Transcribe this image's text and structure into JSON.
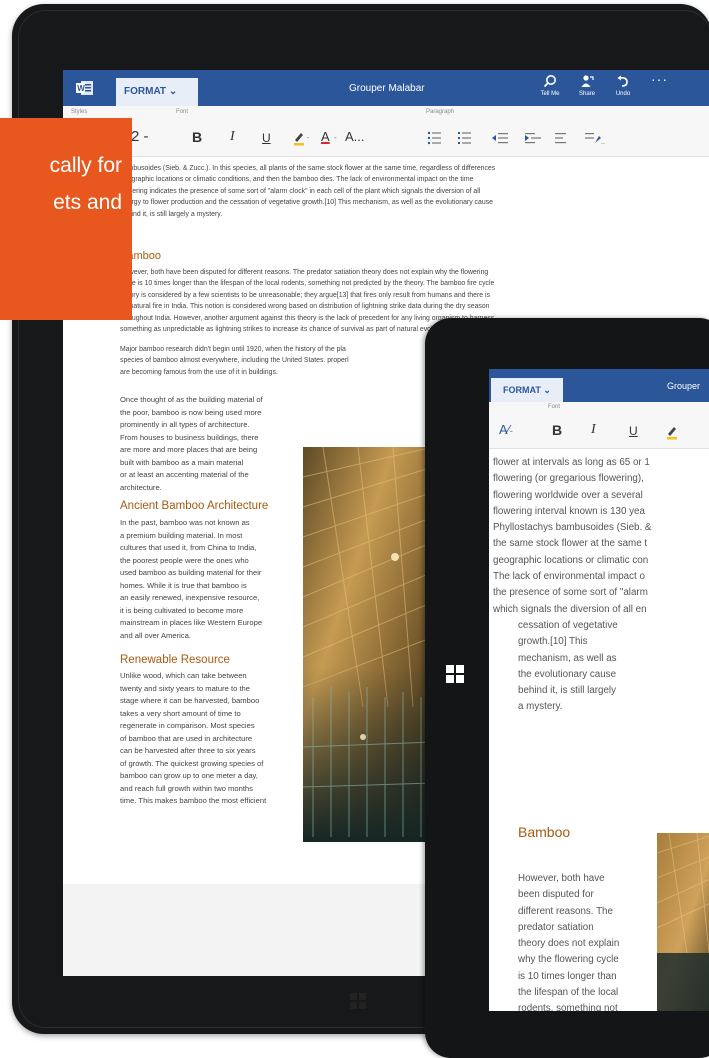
{
  "big_tablet": {
    "app": {
      "format_tab": "FORMAT",
      "doc_title": "Grouper Malabar",
      "commands": {
        "tell_me": "Tell Me",
        "share": "Share",
        "undo": "Undo"
      },
      "more": "···"
    },
    "toolbar": {
      "groups": {
        "styles": "Styles",
        "font": "Font",
        "paragraph": "Paragraph"
      },
      "style_value": "Heading 2 -",
      "bold": "B",
      "italic": "I",
      "underline": "U",
      "font_color": "A",
      "font_more": "A...",
      "highlight_color": "#f4c21a",
      "font_color_bar": "#d9262b"
    },
    "doc": {
      "intro_lines": [
        "bambusoides (Sieb. & Zucc.). In this species, all plants of the same stock flower at the same time, regardless of differences",
        "geographic locations or climatic conditions, and then the bamboo dies. The lack of environmental impact on the time",
        "flowering indicates the presence of some sort of \"alarm clock\" in each cell of the plant which signals the diversion of all",
        "energy to flower production and the cessation of vegetative growth.[10] This mechanism, as well as the evolutionary cause",
        "behind it, is still largely a mystery."
      ],
      "heading1": "Bamboo",
      "para1_lines": [
        "However, both have been disputed for different reasons. The predator satiation theory does not explain why the flowering",
        "cycle is 10 times longer than the lifespan of the local rodents, something not predicted by the theory. The bamboo fire cycle",
        "theory is considered by a few scientists to be unreasonable; they argue[13] that fires only result from humans and there is",
        "no natural fire in India. This notion is considered wrong based on distribution of lightning strike data during the dry season",
        "throughout India. However, another argument against this theory is the lack of precedent for any living organism to harness",
        "something as unpredictable as lightning strikes to increase its chance of survival as part of natural evolutionary progress.[14]"
      ],
      "para2_lines": [
        "Major bamboo research didn't begin until 1920, when the history of the pla",
        "species of bamboo almost everywhere, including the United States. properl",
        "are becoming famous from the use of it in buildings."
      ],
      "col_para_lines": [
        "Once thought of as the building material of",
        "the poor, bamboo is now being used more",
        "prominently in all types of architecture.",
        "From houses to business buildings, there",
        "are more and more places that are being",
        "built with bamboo as a main material",
        "or at least an accenting material of the",
        "architecture."
      ],
      "heading2": "Ancient Bamboo Architecture",
      "ancient_lines": [
        "In the past, bamboo was not known as",
        "a premium building material. In most",
        "cultures that used it, from China to India,",
        "the poorest people were the ones who",
        "used bamboo as building material for their",
        "homes. While it is true that bamboo is",
        "an easily renewed, inexpensive resource,",
        "it is being cultivated to become more",
        "mainstream in places like Western Europe",
        "and all over America."
      ],
      "heading3": "Renewable Resource",
      "renewable_lines": [
        "Unlike wood, which can take between",
        "twenty and sixty years to mature to the",
        "stage where it can be harvested, bamboo",
        "takes a very short amount of time to",
        "regenerate in comparison. Most species",
        "of bamboo that are used in architecture",
        "can be harvested after three to six years",
        "of growth. The quickest growing species of",
        "bamboo can grow up to one meter a day,",
        "and reach full growth within two months",
        "time. This makes bamboo the most efficient"
      ]
    }
  },
  "callout": {
    "line1": "cally for",
    "line2": "ets and",
    "color": "#e8581e"
  },
  "small_tablet": {
    "format_tab": "FORMAT",
    "doc_title": "Grouper",
    "toolbar": {
      "font_group": "Font",
      "bold": "B",
      "italic": "I",
      "underline": "U"
    },
    "text_lines": [
      "flower at intervals as long as 65 or 1",
      "flowering (or gregarious flowering),",
      "flowering worldwide over a several",
      "flowering interval known is 130 yea",
      "Phyllostachys bambusoides (Sieb. &",
      "the same stock flower at the same t",
      "geographic locations or climatic con",
      "The lack of environmental impact o",
      "the presence of some sort of \"alarm",
      "which signals the diversion of all en"
    ],
    "narrow_lines": [
      "cessation of vegetative",
      "growth.[10] This",
      "mechanism, as well as",
      "the evolutionary cause",
      "behind it, is still largely",
      "a mystery."
    ],
    "heading": "Bamboo",
    "bamboo_lines": [
      "However, both have",
      "been disputed for",
      "different reasons. The",
      "predator satiation",
      "theory does not explain",
      "why the flowering cycle",
      "is 10 times longer than",
      "the lifespan of the local",
      "rodents, something not"
    ]
  },
  "theme": {
    "word_blue": "#2b579a",
    "heading_brown": "#a65b12"
  }
}
